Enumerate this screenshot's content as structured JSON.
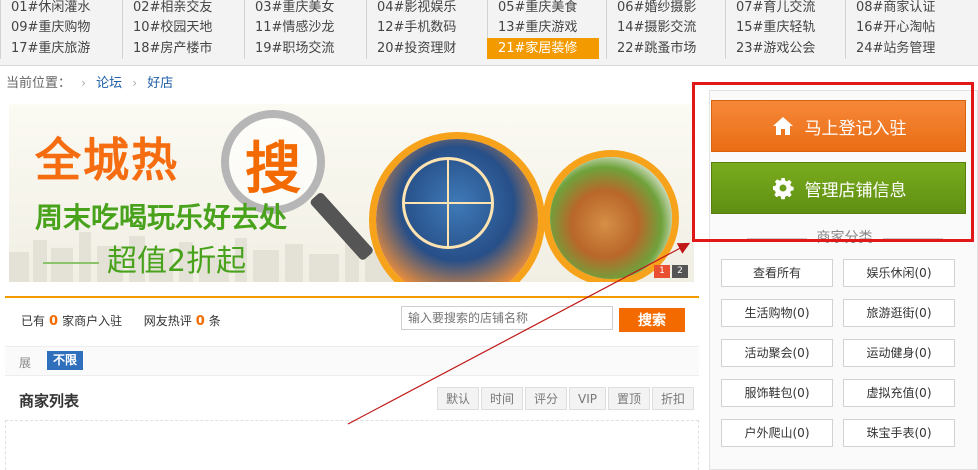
{
  "forums": [
    {
      "label": "01#休闲灌水"
    },
    {
      "label": "02#相亲交友"
    },
    {
      "label": "03#重庆美女"
    },
    {
      "label": "04#影视娱乐"
    },
    {
      "label": "05#重庆美食"
    },
    {
      "label": "06#婚纱摄影"
    },
    {
      "label": "07#育儿交流"
    },
    {
      "label": "08#商家认证"
    },
    {
      "label": "09#重庆购物"
    },
    {
      "label": "10#校园天地"
    },
    {
      "label": "11#情感沙龙"
    },
    {
      "label": "12#手机数码"
    },
    {
      "label": "13#重庆游戏"
    },
    {
      "label": "14#摄影交流"
    },
    {
      "label": "15#重庆轻轨"
    },
    {
      "label": "16#开心淘帖"
    },
    {
      "label": "17#重庆旅游"
    },
    {
      "label": "18#房产楼市"
    },
    {
      "label": "19#职场交流"
    },
    {
      "label": "20#投资理财"
    },
    {
      "label": "21#家居装修"
    },
    {
      "label": "22#跳蚤市场"
    },
    {
      "label": "23#游戏公会"
    },
    {
      "label": "24#站务管理"
    }
  ],
  "active_forum": "21#家居装修",
  "breadcrumb": {
    "prefix": "当前位置：",
    "items": [
      "论坛",
      "好店"
    ]
  },
  "banner": {
    "title": "全城热",
    "search_word": "搜",
    "subtitle": "周末吃喝玩乐好去处",
    "deal": "超值2折起",
    "pager": [
      "1",
      "2"
    ]
  },
  "stats": {
    "merchants_prefix": "已有",
    "merchants_count": "0",
    "merchants_suffix": "家商户入驻",
    "reviews_prefix": "网友热评",
    "reviews_count": "0",
    "reviews_suffix": "条"
  },
  "search": {
    "placeholder": "输入要搜索的店铺名称",
    "button": "搜索"
  },
  "filter": {
    "label": "展",
    "tag": "不限"
  },
  "list": {
    "title": "商家列表",
    "sort_tabs": [
      "默认",
      "时间",
      "评分",
      "VIP",
      "置顶",
      "折扣"
    ]
  },
  "sidebar": {
    "join_button": "马上登记入驻",
    "manage_button": "管理店铺信息",
    "category_title": "商家分类",
    "categories": [
      "查看所有",
      "娱乐休闲(0)",
      "生活购物(0)",
      "旅游逛街(0)",
      "活动聚会(0)",
      "运动健身(0)",
      "服饰鞋包(0)",
      "虚拟充值(0)",
      "户外爬山(0)",
      "珠宝手表(0)"
    ]
  },
  "colors": {
    "accent_orange": "#f36a00",
    "active_tab": "#f39a00",
    "manage_green": "#6a9c18",
    "link_blue": "#1f5fa8",
    "annotation_red": "#e01818"
  }
}
